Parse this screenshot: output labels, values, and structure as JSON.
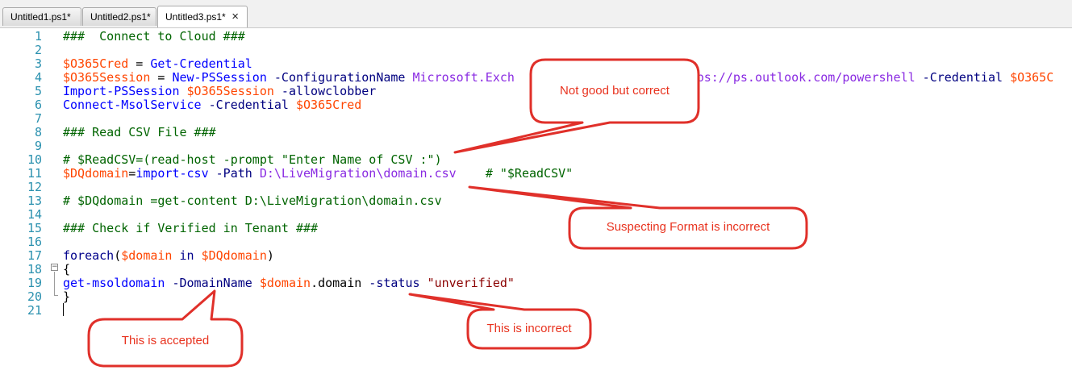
{
  "tabs": [
    {
      "label": "Untitled1.ps1*",
      "active": false
    },
    {
      "label": "Untitled2.ps1*",
      "active": false
    },
    {
      "label": "Untitled3.ps1*",
      "active": true,
      "close_icon": "×"
    }
  ],
  "colors": {
    "line_number": "#2b91af",
    "comment": "#006400",
    "variable": "#ff4500",
    "command": "#0000ff",
    "parameter": "#000080",
    "string": "#8b0000",
    "keyword": "#00008b",
    "argument": "#8a2be2",
    "callout_border": "#e0302a",
    "callout_text": "#e8321e"
  },
  "editor": {
    "lines": [
      {
        "n": "1",
        "tokens": [
          {
            "t": "###  Connect to Cloud ###",
            "c": "comment"
          }
        ]
      },
      {
        "n": "2",
        "tokens": []
      },
      {
        "n": "3",
        "tokens": [
          {
            "t": "$O365Cred",
            "c": "variable"
          },
          {
            "t": " = ",
            "c": "plain"
          },
          {
            "t": "Get-Credential",
            "c": "command"
          }
        ]
      },
      {
        "n": "4",
        "tokens": [
          {
            "t": "$O365Session",
            "c": "variable"
          },
          {
            "t": " = ",
            "c": "plain"
          },
          {
            "t": "New-PSSession",
            "c": "command"
          },
          {
            "t": " -ConfigurationName ",
            "c": "parameter"
          },
          {
            "t": "Microsoft.Exch",
            "c": "argument"
          },
          {
            "t": "                        ",
            "c": "plain"
          },
          {
            "t": "tps://ps.outlook.com/powershell",
            "c": "argument"
          },
          {
            "t": " -Credential ",
            "c": "parameter"
          },
          {
            "t": "$O365C",
            "c": "variable"
          }
        ]
      },
      {
        "n": "5",
        "tokens": [
          {
            "t": "Import-PSSession",
            "c": "command"
          },
          {
            "t": " ",
            "c": "plain"
          },
          {
            "t": "$O365Session",
            "c": "variable"
          },
          {
            "t": " -allowclobber",
            "c": "parameter"
          }
        ]
      },
      {
        "n": "6",
        "tokens": [
          {
            "t": "Connect-MsolService",
            "c": "command"
          },
          {
            "t": " -Credential ",
            "c": "parameter"
          },
          {
            "t": "$O365Cred",
            "c": "variable"
          }
        ]
      },
      {
        "n": "7",
        "tokens": []
      },
      {
        "n": "8",
        "tokens": [
          {
            "t": "### Read CSV File ###",
            "c": "comment"
          }
        ]
      },
      {
        "n": "9",
        "tokens": []
      },
      {
        "n": "10",
        "tokens": [
          {
            "t": "# $ReadCSV=(read-host -prompt \"Enter Name of CSV :\")",
            "c": "comment"
          }
        ]
      },
      {
        "n": "11",
        "tokens": [
          {
            "t": "$DQdomain",
            "c": "variable"
          },
          {
            "t": "=",
            "c": "plain"
          },
          {
            "t": "import-csv",
            "c": "command"
          },
          {
            "t": " -Path ",
            "c": "parameter"
          },
          {
            "t": "D:\\LiveMigration\\domain.csv",
            "c": "argument"
          },
          {
            "t": "    ",
            "c": "plain"
          },
          {
            "t": "# \"$ReadCSV\"",
            "c": "comment"
          }
        ]
      },
      {
        "n": "12",
        "tokens": []
      },
      {
        "n": "13",
        "tokens": [
          {
            "t": "# $DQdomain =get-content D:\\LiveMigration\\domain.csv",
            "c": "comment"
          }
        ]
      },
      {
        "n": "14",
        "tokens": []
      },
      {
        "n": "15",
        "tokens": [
          {
            "t": "### Check if Verified in Tenant ###",
            "c": "comment"
          }
        ]
      },
      {
        "n": "16",
        "tokens": []
      },
      {
        "n": "17",
        "tokens": [
          {
            "t": "foreach",
            "c": "keyword"
          },
          {
            "t": "(",
            "c": "plain"
          },
          {
            "t": "$domain",
            "c": "variable"
          },
          {
            "t": " in ",
            "c": "keyword"
          },
          {
            "t": "$DQdomain",
            "c": "variable"
          },
          {
            "t": ")",
            "c": "plain"
          }
        ]
      },
      {
        "n": "18",
        "tokens": [
          {
            "t": "{",
            "c": "plain"
          }
        ]
      },
      {
        "n": "19",
        "tokens": [
          {
            "t": "get-msoldomain",
            "c": "command"
          },
          {
            "t": " -DomainName ",
            "c": "parameter"
          },
          {
            "t": "$domain",
            "c": "variable"
          },
          {
            "t": ".",
            "c": "plain"
          },
          {
            "t": "domain",
            "c": "plain"
          },
          {
            "t": " -status ",
            "c": "parameter"
          },
          {
            "t": "\"unverified\"",
            "c": "string"
          }
        ]
      },
      {
        "n": "20",
        "tokens": [
          {
            "t": "}",
            "c": "plain"
          }
        ]
      },
      {
        "n": "21",
        "tokens": []
      }
    ],
    "fold_icon": "minus-box"
  },
  "callouts": [
    {
      "text": "Not good but correct"
    },
    {
      "text": "Suspecting Format is incorrect"
    },
    {
      "text": "This is incorrect"
    },
    {
      "text": "This is accepted"
    }
  ]
}
